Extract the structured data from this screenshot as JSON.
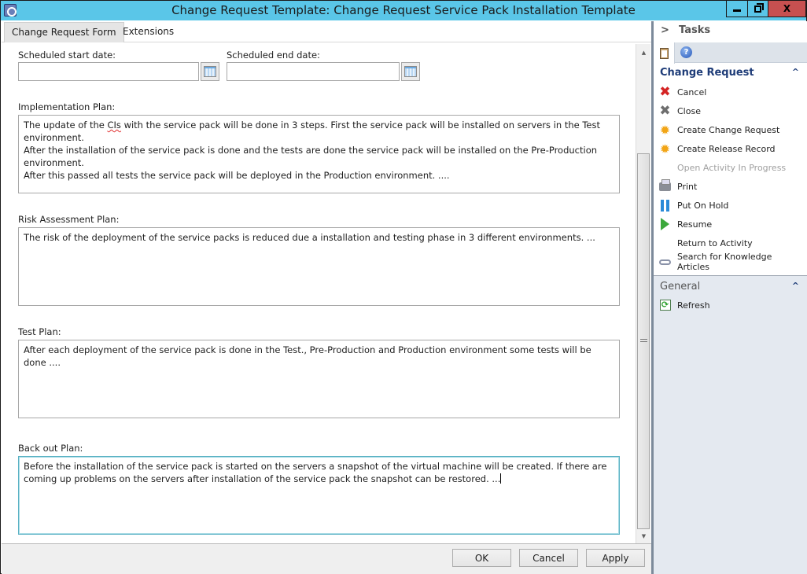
{
  "window": {
    "title": "Change Request Template: Change Request Service Pack Installation Template",
    "controls": {
      "minimize": "minimize",
      "restore": "restore",
      "close": "X"
    }
  },
  "tabs": [
    {
      "label": "Change Request Form",
      "active": true
    },
    {
      "label": "Extensions",
      "active": false
    }
  ],
  "form": {
    "scheduled_start": {
      "label": "Scheduled start date:",
      "value": ""
    },
    "scheduled_end": {
      "label": "Scheduled end date:",
      "value": ""
    },
    "implementation_plan": {
      "label": "Implementation Plan:",
      "line1_pre": "The update of the ",
      "line1_flagged": "CIs",
      "line1_post": " with the service pack will be done in 3 steps. First the service pack will be installed on servers in the Test environment.",
      "rest": "After the installation of the service pack is done and the tests are done the service pack will be installed on the Pre-Production environment.\nAfter this passed all tests the service pack will be deployed in the Production environment. ...."
    },
    "risk_assessment_plan": {
      "label": "Risk Assessment Plan:",
      "value": "The risk of the deployment of the service packs is reduced due a installation and testing phase in 3 different environments. ..."
    },
    "test_plan": {
      "label": "Test Plan:",
      "value": "After each deployment of the service pack is done in the Test., Pre-Production and Production environment some tests will be done ...."
    },
    "back_out_plan": {
      "label": "Back out Plan:",
      "value": "Before the installation of the service pack is started on the servers a snapshot of the virtual machine will be created. If there are coming up problems on the servers after installation of the service pack the snapshot can be restored. ..."
    }
  },
  "buttons": {
    "ok": "OK",
    "cancel": "Cancel",
    "apply": "Apply"
  },
  "task_pane": {
    "header": "Tasks",
    "expand_glyph": ">",
    "help_glyph": "?",
    "sections": [
      {
        "title": "Change Request",
        "collapse_glyph": "^",
        "items": [
          {
            "label": "Cancel",
            "icon": "cancel-icon",
            "enabled": true
          },
          {
            "label": "Close",
            "icon": "close-icon",
            "enabled": true
          },
          {
            "label": "Create Change Request",
            "icon": "create-icon",
            "enabled": true
          },
          {
            "label": "Create Release Record",
            "icon": "create-icon",
            "enabled": true
          },
          {
            "label": "Open Activity In Progress",
            "icon": "",
            "enabled": false
          },
          {
            "label": "Print",
            "icon": "printer-icon",
            "enabled": true
          },
          {
            "label": "Put On Hold",
            "icon": "pause-icon",
            "enabled": true
          },
          {
            "label": "Resume",
            "icon": "play-icon",
            "enabled": true
          },
          {
            "label": "Return to Activity",
            "icon": "",
            "enabled": true
          },
          {
            "label": "Search for Knowledge Articles",
            "icon": "link-icon",
            "enabled": true
          }
        ]
      },
      {
        "title": "General",
        "collapse_glyph": "^",
        "items": [
          {
            "label": "Refresh",
            "icon": "refresh-icon",
            "enabled": true
          }
        ]
      }
    ]
  }
}
